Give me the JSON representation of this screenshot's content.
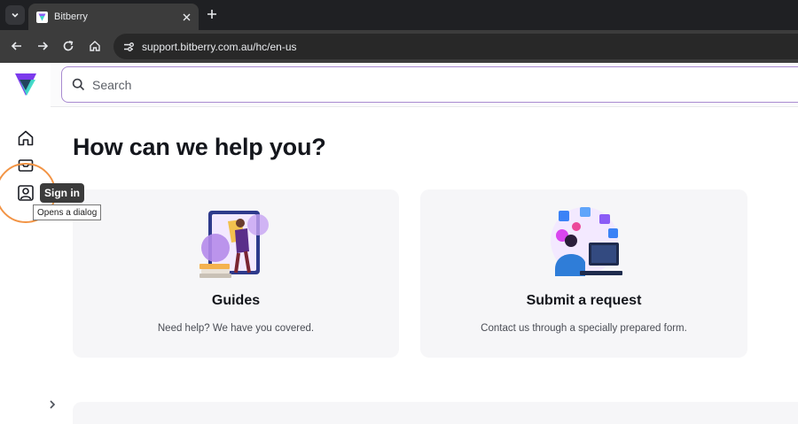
{
  "browser": {
    "tab_title": "Bitberry",
    "url": "support.bitberry.com.au/hc/en-us"
  },
  "search": {
    "placeholder": "Search"
  },
  "page": {
    "heading": "How can we help you?"
  },
  "tooltip": {
    "label": "Sign in",
    "hint": "Opens a dialog"
  },
  "cards": [
    {
      "title": "Guides",
      "description": "Need help? We have you covered."
    },
    {
      "title": "Submit a request",
      "description": "Contact us through a specially prepared form."
    }
  ],
  "colors": {
    "accent": "#8b5cf6",
    "highlight": "#f29445",
    "brand_teal": "#3ddbc6"
  },
  "icons": {
    "sidebar": [
      "home-icon",
      "inbox-icon",
      "user-icon"
    ],
    "toolbar": [
      "back-icon",
      "forward-icon",
      "reload-icon",
      "home-icon",
      "site-info-icon"
    ]
  }
}
